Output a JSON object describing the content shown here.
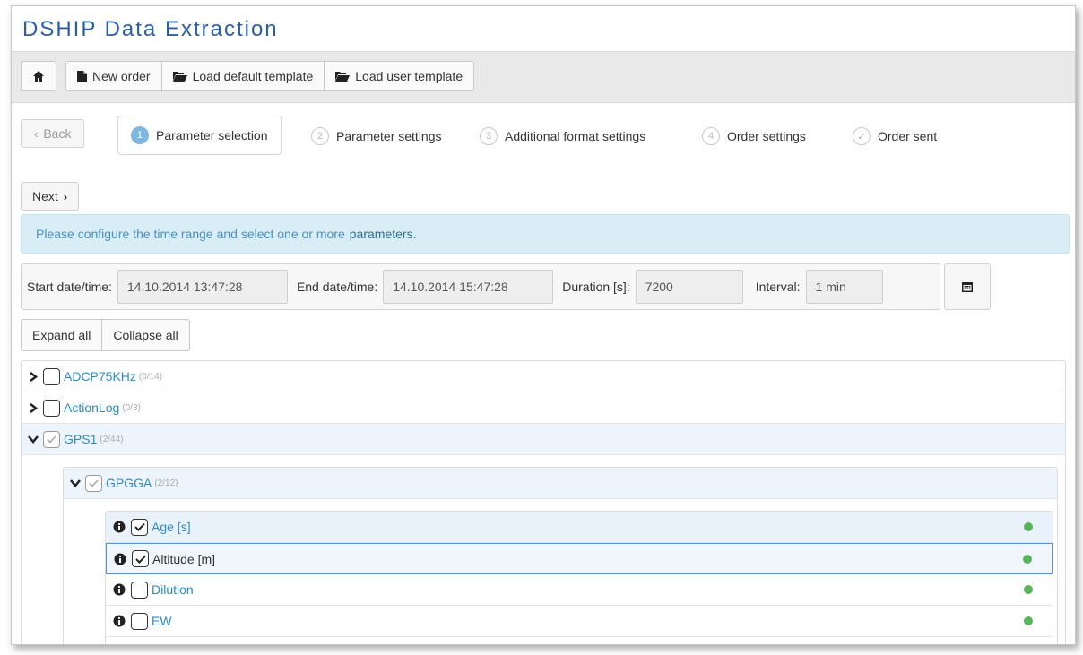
{
  "app": {
    "title": "DSHIP Data Extraction"
  },
  "toolbar": {
    "home_icon": "home-icon",
    "new_order": "New order",
    "load_default": "Load default template",
    "load_user": "Load user template"
  },
  "wizard": {
    "back": "Back",
    "steps": [
      {
        "num": "1",
        "label": "Parameter selection"
      },
      {
        "num": "2",
        "label": "Parameter settings"
      },
      {
        "num": "3",
        "label": "Additional format settings"
      },
      {
        "num": "4",
        "label": "Order settings"
      },
      {
        "num": "",
        "label": "Order sent"
      }
    ],
    "next": "Next"
  },
  "alert": {
    "text": "Please configure the time range and select one or more",
    "link": "parameters."
  },
  "time_range": {
    "start_label": "Start date/time:",
    "start_value": "14.10.2014 13:47:28",
    "end_label": "End date/time:",
    "end_value": "14.10.2014 15:47:28",
    "duration_label": "Duration [s]:",
    "duration_value": "7200",
    "interval_label": "Interval:",
    "interval_value": "1 min"
  },
  "tree_controls": {
    "expand": "Expand all",
    "collapse": "Collapse all"
  },
  "tree": {
    "nodes": [
      {
        "label": "ADCP75KHz",
        "count": "(0/14)"
      },
      {
        "label": "ActionLog",
        "count": "(0/3)"
      },
      {
        "label": "GPS1",
        "count": "(2/44)"
      }
    ],
    "sub": {
      "label": "GPGGA",
      "count": "(2/12)"
    },
    "leaves": [
      {
        "label": "Age [s]",
        "checked": true
      },
      {
        "label": "Altitude [m]",
        "checked": true
      },
      {
        "label": "Dilution",
        "checked": false
      },
      {
        "label": "EW",
        "checked": false
      }
    ]
  },
  "colors": {
    "title": "#2a5fa8",
    "link": "#2c8bc7",
    "status_ok": "#58b35a",
    "alert_bg": "#d9edf7"
  }
}
